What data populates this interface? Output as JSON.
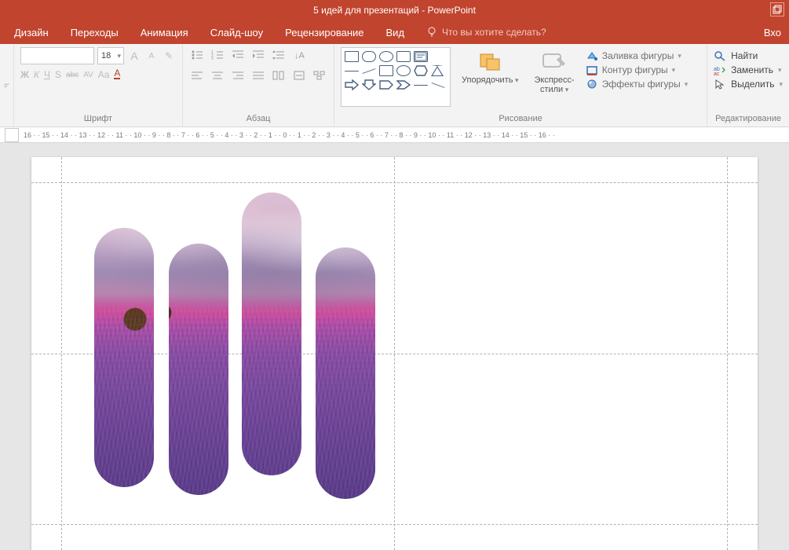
{
  "title": "5 идей для презентаций - PowerPoint",
  "menu": {
    "design": "Дизайн",
    "transitions": "Переходы",
    "animation": "Анимация",
    "slideshow": "Слайд-шоу",
    "review": "Рецензирование",
    "view": "Вид",
    "tellme": "Что вы хотите сделать?",
    "right": "Вхо"
  },
  "ribbon": {
    "leftedge": "ь",
    "font": {
      "size": "18",
      "bold": "Ж",
      "italic": "К",
      "underline": "Ч",
      "strike": "S",
      "spacing": "abc",
      "sub": "AV",
      "case": "Aa",
      "color": "A",
      "growA": "A",
      "shrinkA": "A",
      "clear": "✎",
      "label": "Шрифт"
    },
    "para": {
      "label": "Абзац"
    },
    "draw": {
      "arrange": "Упорядочить",
      "express": "Экспресс-\nстили",
      "fill": "Заливка фигуры",
      "outline": "Контур фигуры",
      "effects": "Эффекты фигуры",
      "label": "Рисование"
    },
    "edit": {
      "find": "Найти",
      "replace": "Заменить",
      "select": "Выделить",
      "label": "Редактирование"
    }
  },
  "ruler": "16 · · 15 · · 14 · · 13 · · 12 · · 11 · · 10 · · 9 · · 8 · · 7 · · 6 · · 5 · · 4 · · 3 · · 2 · · 1 · · 0 · · 1 · · 2 · · 3 · · 4 · · 5 · · 6 · · 7 · · 8 · · 9 · · 10 · · 11 · · 12 · · 13 · · 14 · · 15 · · 16 · ·"
}
